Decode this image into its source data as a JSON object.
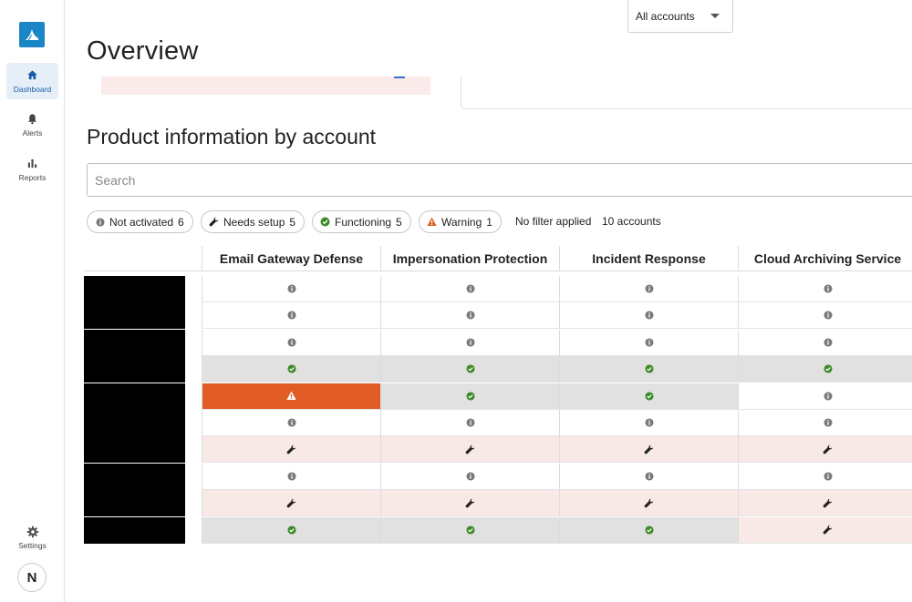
{
  "app": {
    "nav": [
      {
        "id": "dashboard",
        "label": "Dashboard",
        "icon": "home-icon",
        "active": true
      },
      {
        "id": "alerts",
        "label": "Alerts",
        "icon": "bell-icon",
        "active": false
      },
      {
        "id": "reports",
        "label": "Reports",
        "icon": "bar-chart-icon",
        "active": false
      }
    ],
    "settings_label": "Settings",
    "avatar_initial": "N"
  },
  "header": {
    "account_select": "All accounts",
    "page_title": "Overview"
  },
  "product_section": {
    "title": "Product information by account",
    "search_placeholder": "Search",
    "filters": [
      {
        "id": "not-activated",
        "label": "Not activated",
        "count": "6",
        "icon": "info-icon"
      },
      {
        "id": "needs-setup",
        "label": "Needs setup",
        "count": "5",
        "icon": "wrench-icon"
      },
      {
        "id": "functioning",
        "label": "Functioning",
        "count": "5",
        "icon": "check-circle-icon"
      },
      {
        "id": "warning",
        "label": "Warning",
        "count": "1",
        "icon": "warning-icon"
      }
    ],
    "filter_status": "No filter applied",
    "account_count": "10 accounts",
    "columns": [
      "Email Gateway Defense",
      "Impersonation Protection",
      "Incident Response",
      "Cloud Archiving Service"
    ],
    "rows": [
      [
        "info",
        "info",
        "info",
        "info"
      ],
      [
        "info",
        "info",
        "info",
        "info"
      ],
      [
        "info",
        "info",
        "info",
        "info"
      ],
      [
        "check",
        "check",
        "check",
        "check"
      ],
      [
        "warning",
        "check",
        "check",
        "info"
      ],
      [
        "info",
        "info",
        "info",
        "info"
      ],
      [
        "wrench",
        "wrench",
        "wrench",
        "wrench"
      ],
      [
        "info",
        "info",
        "info",
        "info"
      ],
      [
        "wrench",
        "wrench",
        "wrench",
        "wrench"
      ],
      [
        "check",
        "check",
        "check",
        "wrench"
      ]
    ]
  },
  "colors": {
    "brand": "#1b86c6",
    "functioning": "#3a8a2a",
    "warning": "#e25d26",
    "needs_setup_bg": "#f8e9e6",
    "functioning_bg": "#e2e1e1"
  }
}
